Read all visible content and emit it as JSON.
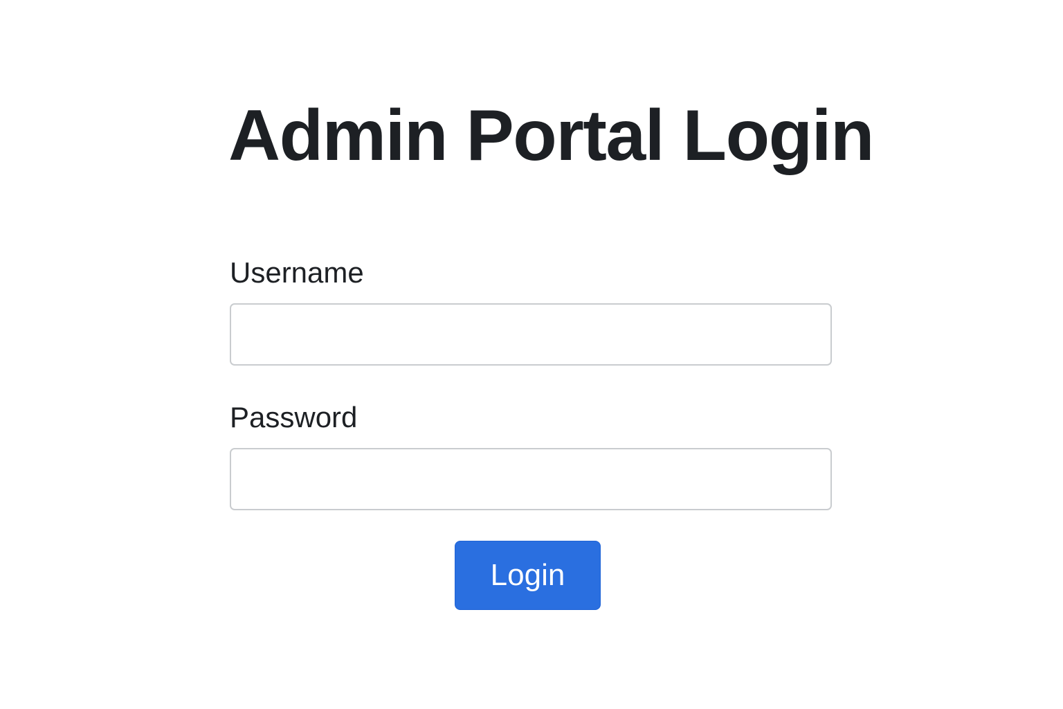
{
  "page": {
    "title": "Admin Portal Login"
  },
  "form": {
    "username": {
      "label": "Username",
      "value": "",
      "placeholder": ""
    },
    "password": {
      "label": "Password",
      "value": "",
      "placeholder": ""
    },
    "submit_label": "Login"
  },
  "colors": {
    "background": "#ffffff",
    "text": "#1d2024",
    "input_border": "#c9cccf",
    "button_bg": "#2a6fe0",
    "button_text": "#ffffff"
  }
}
